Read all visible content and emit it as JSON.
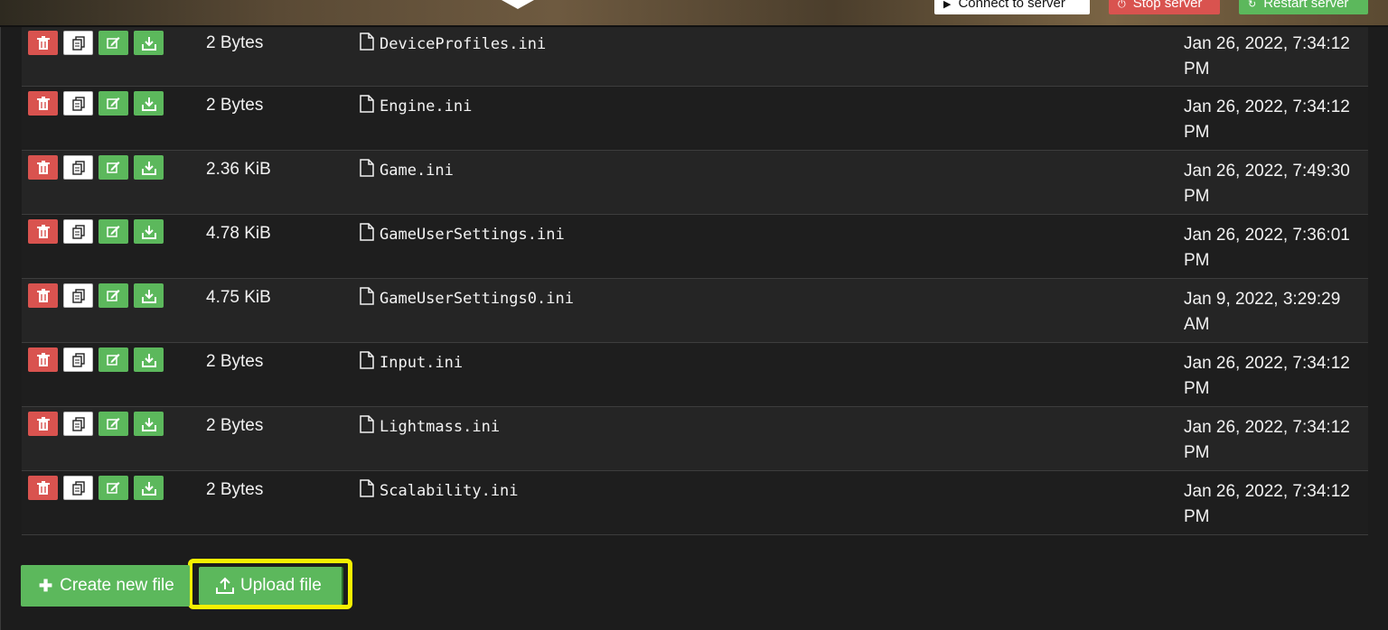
{
  "header": {
    "connect_label": "Connect to server",
    "stop_label": "Stop server",
    "restart_label": "Restart server"
  },
  "files": [
    {
      "size": "2 Bytes",
      "name": "DeviceProfiles.ini",
      "date": "Jan 26, 2022, 7:34:12 PM"
    },
    {
      "size": "2 Bytes",
      "name": "Engine.ini",
      "date": "Jan 26, 2022, 7:34:12 PM"
    },
    {
      "size": "2.36 KiB",
      "name": "Game.ini",
      "date": "Jan 26, 2022, 7:49:30 PM"
    },
    {
      "size": "4.78 KiB",
      "name": "GameUserSettings.ini",
      "date": "Jan 26, 2022, 7:36:01 PM"
    },
    {
      "size": "4.75 KiB",
      "name": "GameUserSettings0.ini",
      "date": "Jan 9, 2022, 3:29:29 AM"
    },
    {
      "size": "2 Bytes",
      "name": "Input.ini",
      "date": "Jan 26, 2022, 7:34:12 PM"
    },
    {
      "size": "2 Bytes",
      "name": "Lightmass.ini",
      "date": "Jan 26, 2022, 7:34:12 PM"
    },
    {
      "size": "2 Bytes",
      "name": "Scalability.ini",
      "date": "Jan 26, 2022, 7:34:12 PM"
    }
  ],
  "actions": {
    "create_label": "Create new file",
    "upload_label": "Upload file"
  },
  "colors": {
    "danger": "#d9534f",
    "success": "#5cb85c",
    "highlight": "#f5f000",
    "background": "#1c1c1c"
  },
  "icons": {
    "delete": "trash-icon",
    "copy": "copy-icon",
    "edit": "edit-icon",
    "download": "download-icon",
    "file": "file-icon",
    "create": "plus-icon",
    "upload": "upload-icon"
  }
}
